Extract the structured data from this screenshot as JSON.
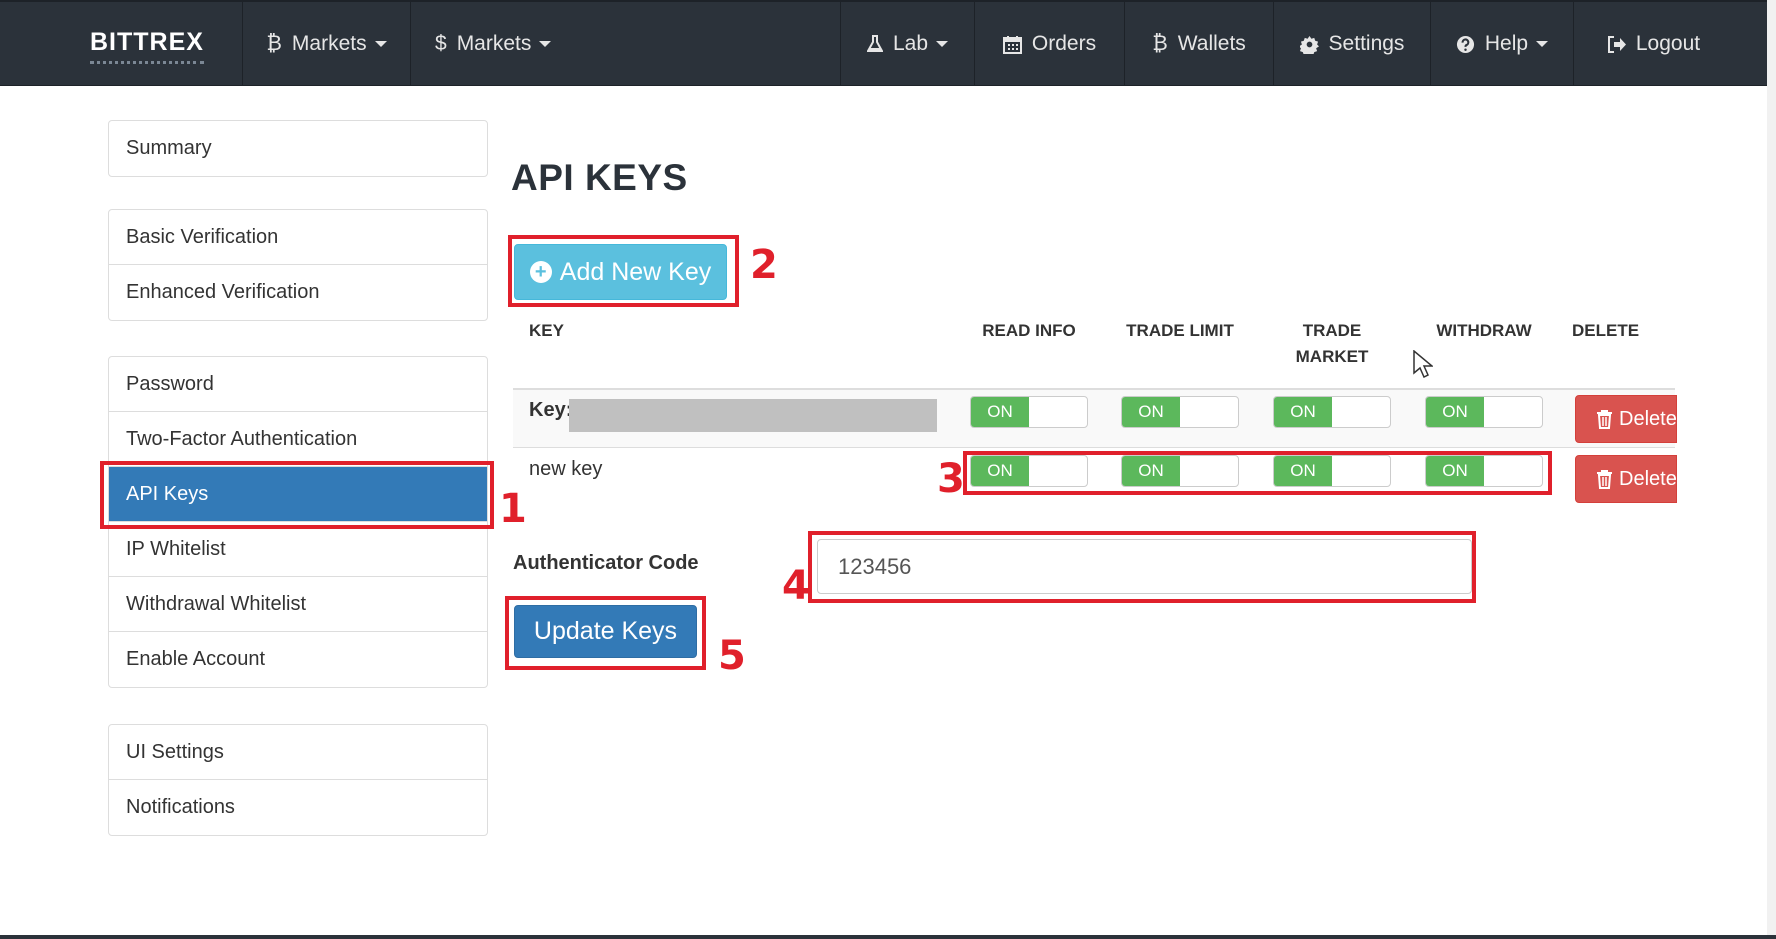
{
  "navbar": {
    "brand": "BITTREX",
    "items": [
      {
        "label": "Markets",
        "icon": "bitcoin-icon",
        "dropdown": true
      },
      {
        "label": "Markets",
        "icon": "dollar-icon",
        "dropdown": true
      },
      {
        "label": "Lab",
        "icon": "flask-icon",
        "dropdown": true
      },
      {
        "label": "Orders",
        "icon": "calendar-icon",
        "dropdown": false
      },
      {
        "label": "Wallets",
        "icon": "bitcoin-icon",
        "dropdown": false
      },
      {
        "label": "Settings",
        "icon": "gear-icon",
        "dropdown": false
      },
      {
        "label": "Help",
        "icon": "question-circle-icon",
        "dropdown": true
      },
      {
        "label": "Logout",
        "icon": "sign-out-icon",
        "dropdown": false
      }
    ],
    "icon_glyphs": {
      "bitcoin": "₿",
      "dollar": "$"
    }
  },
  "sidebar": {
    "groups": [
      [
        "Summary"
      ],
      [
        "Basic Verification",
        "Enhanced Verification"
      ],
      [
        "Password",
        "Two-Factor Authentication",
        "API Keys",
        "IP Whitelist",
        "Withdrawal Whitelist",
        "Enable Account"
      ],
      [
        "UI Settings",
        "Notifications"
      ]
    ],
    "active": "API Keys"
  },
  "main": {
    "title": "API KEYS",
    "add_button": "Add New Key",
    "add_button_icon": "+",
    "table": {
      "headers": {
        "key": "KEY",
        "read_info": "READ INFO",
        "trade_limit": "TRADE LIMIT",
        "trade_market": "TRADE MARKET",
        "withdraw": "WITHDRAW",
        "delete": "DELETE"
      },
      "rows": [
        {
          "key_label": "Key:",
          "key_value_redacted": true,
          "toggles": [
            "ON",
            "ON",
            "ON",
            "ON"
          ],
          "delete_label": "Delete"
        },
        {
          "key_label": "new key",
          "toggles": [
            "ON",
            "ON",
            "ON",
            "ON"
          ],
          "delete_label": "Delete"
        }
      ]
    },
    "authenticator": {
      "label": "Authenticator Code",
      "value": "123456"
    },
    "update_button": "Update Keys"
  },
  "annotations": [
    "1",
    "2",
    "3",
    "4",
    "5"
  ],
  "colors": {
    "navbar": "#2b323a",
    "active": "#337ab7",
    "info": "#5bc0de",
    "success": "#5cb85c",
    "danger": "#d9534f",
    "annotation": "#e0202b"
  }
}
